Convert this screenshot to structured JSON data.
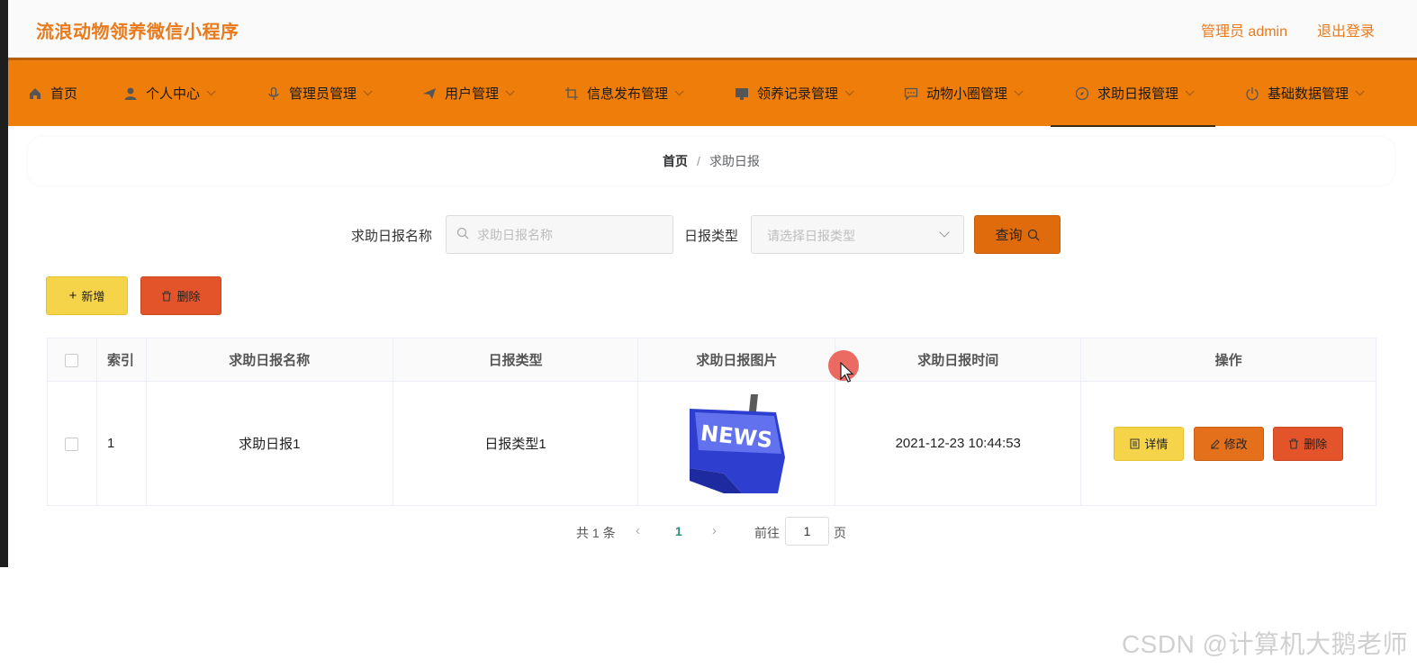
{
  "app": {
    "title": "流浪动物领养微信小程序"
  },
  "topbar": {
    "user": "管理员 admin",
    "logout": "退出登录"
  },
  "nav": {
    "items": [
      {
        "label": "首页",
        "icon": "home-icon"
      },
      {
        "label": "个人中心",
        "icon": "user-icon"
      },
      {
        "label": "管理员管理",
        "icon": "microphone-icon"
      },
      {
        "label": "用户管理",
        "icon": "paper-plane-icon"
      },
      {
        "label": "信息发布管理",
        "icon": "crop-icon"
      },
      {
        "label": "领养记录管理",
        "icon": "monitor-icon"
      },
      {
        "label": "动物小圈管理",
        "icon": "chat-bubble-icon"
      },
      {
        "label": "求助日报管理",
        "icon": "compass-icon"
      },
      {
        "label": "基础数据管理",
        "icon": "power-icon"
      }
    ],
    "active": "求助日报管理"
  },
  "breadcrumb": {
    "home": "首页",
    "separator": "/",
    "current": "求助日报"
  },
  "search": {
    "name_label": "求助日报名称",
    "name_placeholder": "求助日报名称",
    "type_label": "日报类型",
    "type_placeholder": "请选择日报类型",
    "query_button": "查询"
  },
  "actions": {
    "add": "新增",
    "delete": "删除"
  },
  "table": {
    "columns": [
      "索引",
      "求助日报名称",
      "日报类型",
      "求助日报图片",
      "求助日报时间",
      "操作"
    ],
    "rows": [
      {
        "index": "1",
        "name": "求助日报1",
        "type": "日报类型1",
        "image_text": "NEWS",
        "time": "2021-12-23 10:44:53",
        "ops": {
          "detail": "详情",
          "edit": "修改",
          "delete": "删除"
        }
      }
    ]
  },
  "pagination": {
    "total": "共 1 条",
    "current": "1",
    "goto": "前往",
    "goto_value": "1",
    "unit": "页"
  },
  "watermark": "CSDN @计算机大鹅老师",
  "colors": {
    "brand": "#e87a1c",
    "nav_bg": "#ef7d0a",
    "query": "#df6b0c",
    "add": "#f6d44a",
    "delete": "#e4542a",
    "edit": "#e4701c",
    "page_active": "#2a8a85"
  }
}
